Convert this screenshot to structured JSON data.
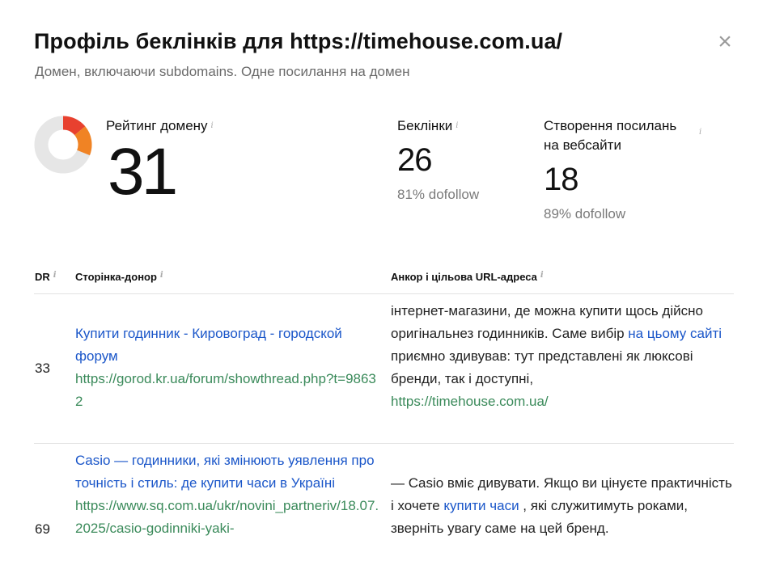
{
  "modal": {
    "title": "Профіль беклінків для https://timehouse.com.ua/",
    "subtitle": "Домен, включаючи subdomains. Одне посилання на домен",
    "close_glyph": "×"
  },
  "stats": {
    "domain_rating": {
      "label": "Рейтинг домену",
      "value": "31",
      "fraction": 0.31
    },
    "backlinks": {
      "label": "Беклінки",
      "value": "26",
      "sub": "81% dofollow"
    },
    "linking_websites": {
      "label_line1": "Створення посилань",
      "label_line2": "на вебсайти",
      "value": "18",
      "sub": "89% dofollow"
    },
    "info_glyph": "i"
  },
  "colors": {
    "donut_track": "#e6e6e6",
    "donut_red": "#e8412f",
    "donut_orange": "#f08324",
    "link": "#1a56c9",
    "url": "#3a8a5a"
  },
  "table": {
    "headers": {
      "dr": "DR",
      "donor": "Сторінка-донор",
      "anchor": "Анкор і цільова URL-адреса"
    },
    "rows": [
      {
        "dr": "33",
        "donor_title": "Купити годинник - Кировоград - городской форум",
        "donor_url": "https://gorod.kr.ua/forum/showthread.php?t=98632",
        "anchor_before": "інтернет-магазини, де можна купити щось дійсно оригінальнез годинників. Саме вибір ",
        "anchor_link": "на цьому сайті",
        "anchor_after": " приємно здивував: тут представлені як люксові бренди, так і доступні,",
        "target_url": "https://timehouse.com.ua/"
      },
      {
        "dr": "69",
        "donor_title": "Casio — годинники, які змінюють уявлення про точність і стиль: де купити часи в Україні",
        "donor_url": "https://www.sq.com.ua/ukr/novini_partneriv/18.07.2025/casio-godinniki-yaki-",
        "anchor_before": "— Casio вміє дивувати. Якщо ви цінуєте практичність і хочете ",
        "anchor_link": "купити часи",
        "anchor_after": " , які служитимуть роками, зверніть увагу саме на цей бренд."
      }
    ]
  }
}
